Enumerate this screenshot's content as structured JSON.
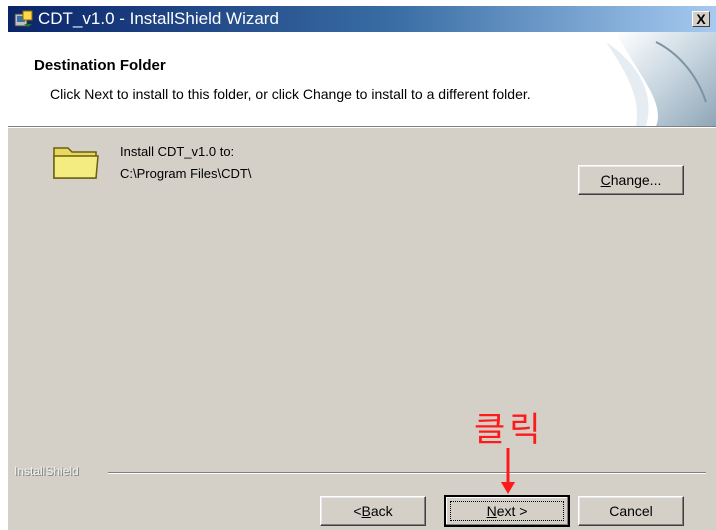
{
  "window": {
    "title": "CDT_v1.0 - InstallShield Wizard",
    "close_label": "X"
  },
  "header": {
    "title": "Destination Folder",
    "subtitle": "Click Next to install to this folder, or click Change to install to a different folder."
  },
  "body": {
    "install_label": "Install CDT_v1.0 to:",
    "install_path": "C:\\Program Files\\CDT\\",
    "change_button": {
      "first": "C",
      "rest": "hange..."
    }
  },
  "footer": {
    "brand": "InstallShield",
    "back_button": {
      "prefix": "< ",
      "first": "B",
      "rest": "ack"
    },
    "next_button": {
      "first": "N",
      "rest": "ext >"
    },
    "cancel_button": "Cancel"
  },
  "annotation": {
    "text": "클릭",
    "color": "#ff1a1a"
  },
  "icons": [
    "installer-app-icon",
    "folder-icon",
    "arrow-down-icon",
    "header-graphic"
  ]
}
